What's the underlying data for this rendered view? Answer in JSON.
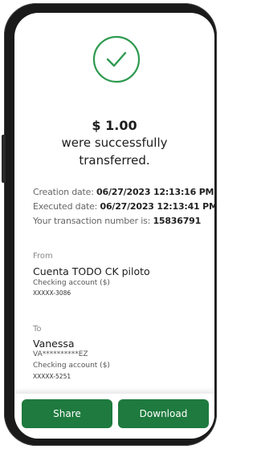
{
  "success": {
    "amount": "$ 1.00",
    "message_line1": "were successfully",
    "message_line2": "transferred."
  },
  "details": {
    "creation_label": "Creation date:",
    "creation_value": "06/27/2023 12:13:16 PM",
    "executed_label": "Executed date:",
    "executed_value": "06/27/2023 12:13:41 PM",
    "txn_label": "Your transaction number is:",
    "txn_value": "15836791"
  },
  "from": {
    "label": "From",
    "name": "Cuenta TODO CK piloto",
    "type": "Checking account ($)",
    "account": "XXXXX-3086"
  },
  "to": {
    "label": "To",
    "name": "Vanessa",
    "masked_id": "VA**********EZ",
    "type": "Checking account ($)",
    "account": "XXXXX-5251"
  },
  "actions": {
    "share_label": "Share",
    "download_label": "Download"
  },
  "colors": {
    "accent": "#1e7a3e",
    "check_ring": "#2e9a4f"
  },
  "icons": {
    "status": "checkmark-circle-icon"
  }
}
